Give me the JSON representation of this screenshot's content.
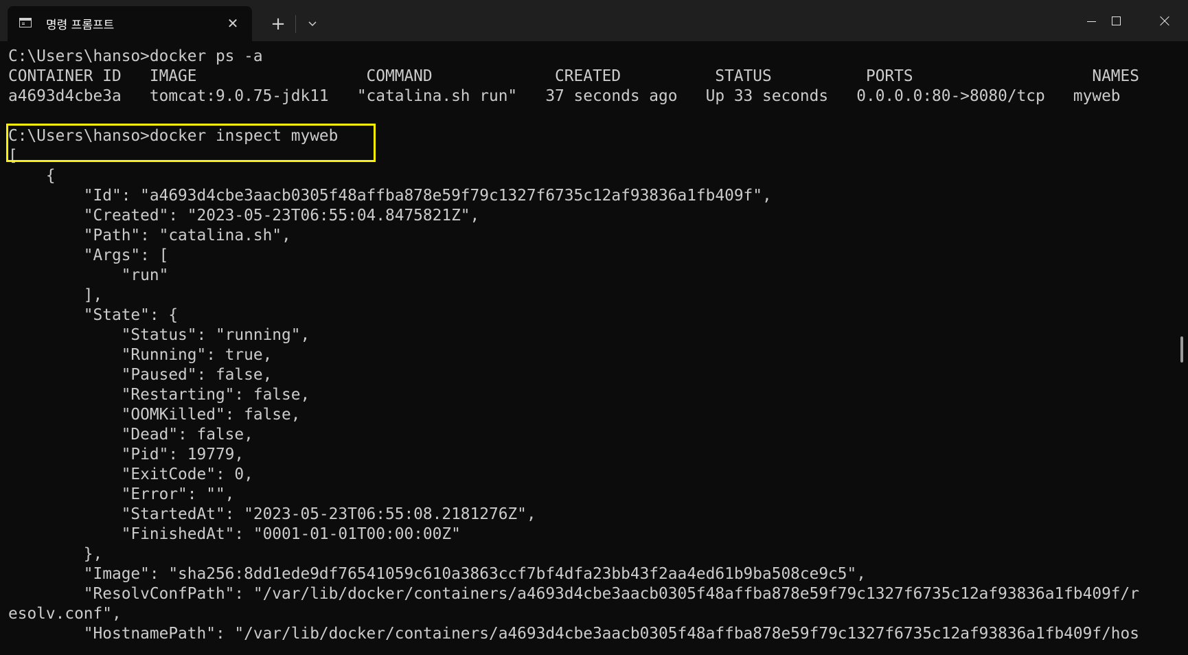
{
  "window": {
    "tab_title": "명령 프롬프트",
    "tab_icon": "terminal-icon",
    "new_tab_label": "+"
  },
  "colors": {
    "background": "#0c0c0c",
    "titlebar": "#1f1f1f",
    "text": "#cccccc",
    "highlight_border": "#fff200"
  },
  "terminal": {
    "lines": [
      "C:\\Users\\hanso>docker ps -a",
      "CONTAINER ID   IMAGE                  COMMAND             CREATED          STATUS          PORTS                   NAMES",
      "a4693d4cbe3a   tomcat:9.0.75-jdk11   \"catalina.sh run\"   37 seconds ago   Up 33 seconds   0.0.0.0:80->8080/tcp   myweb",
      "",
      "C:\\Users\\hanso>docker inspect myweb",
      "[",
      "    {",
      "        \"Id\": \"a4693d4cbe3aacb0305f48affba878e59f79c1327f6735c12af93836a1fb409f\",",
      "        \"Created\": \"2023-05-23T06:55:04.8475821Z\",",
      "        \"Path\": \"catalina.sh\",",
      "        \"Args\": [",
      "            \"run\"",
      "        ],",
      "        \"State\": {",
      "            \"Status\": \"running\",",
      "            \"Running\": true,",
      "            \"Paused\": false,",
      "            \"Restarting\": false,",
      "            \"OOMKilled\": false,",
      "            \"Dead\": false,",
      "            \"Pid\": 19779,",
      "            \"ExitCode\": 0,",
      "            \"Error\": \"\",",
      "            \"StartedAt\": \"2023-05-23T06:55:08.2181276Z\",",
      "            \"FinishedAt\": \"0001-01-01T00:00:00Z\"",
      "        },",
      "        \"Image\": \"sha256:8dd1ede9df76541059c610a3863ccf7bf4dfa23bb43f2aa4ed61b9ba508ce9c5\",",
      "        \"ResolvConfPath\": \"/var/lib/docker/containers/a4693d4cbe3aacb0305f48affba878e59f79c1327f6735c12af93836a1fb409f/r",
      "esolv.conf\",",
      "        \"HostnamePath\": \"/var/lib/docker/containers/a4693d4cbe3aacb0305f48affba878e59f79c1327f6735c12af93836a1fb409f/hos"
    ]
  }
}
